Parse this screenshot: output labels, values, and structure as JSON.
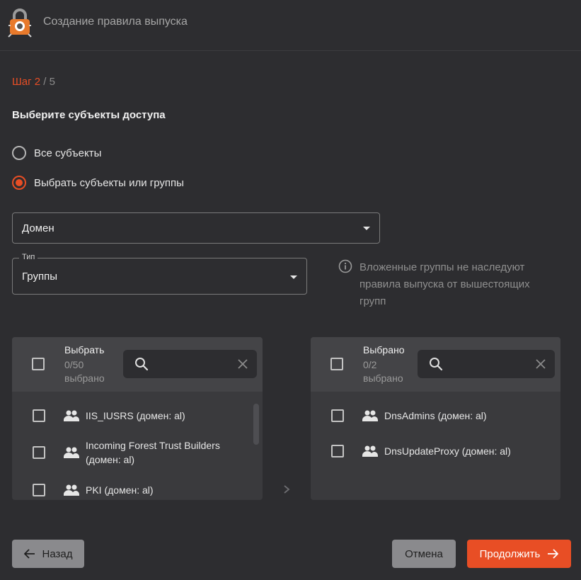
{
  "header": {
    "title": "Создание правила выпуска",
    "logo_icon": "lock-bug-logo"
  },
  "step": {
    "current": "Шаг 2",
    "separator": " / ",
    "total": "5"
  },
  "section_title": "Выберите субъекты доступа",
  "radio_options": [
    {
      "label": "Все субъекты",
      "checked": false
    },
    {
      "label": "Выбрать субъекты или группы",
      "checked": true
    }
  ],
  "domain_select": {
    "value": "Домен"
  },
  "type_select": {
    "legend": "Тип",
    "value": "Группы"
  },
  "info_note": "Вложенные группы не наследуют правила выпуска от вышестоящих групп",
  "available_panel": {
    "title": "Выбрать",
    "count": "0/50",
    "count_suffix": "выбрано",
    "search_value": "",
    "items": [
      {
        "label": "IIS_IUSRS (домен: al)"
      },
      {
        "label": "Incoming Forest Trust Builders (домен: al)"
      },
      {
        "label": "PKI (домен: al)"
      }
    ]
  },
  "selected_panel": {
    "title": "Выбрано",
    "count": "0/2",
    "count_suffix": "выбрано",
    "search_value": "",
    "items": [
      {
        "label": "DnsAdmins (домен: al)"
      },
      {
        "label": "DnsUpdateProxy (домен: al)"
      }
    ]
  },
  "buttons": {
    "back": "Назад",
    "cancel": "Отмена",
    "next": "Продолжить"
  },
  "colors": {
    "accent": "#e84e25",
    "background": "#2d2d30",
    "panel": "#3a3a3d",
    "muted_text": "#8f8f8f"
  }
}
